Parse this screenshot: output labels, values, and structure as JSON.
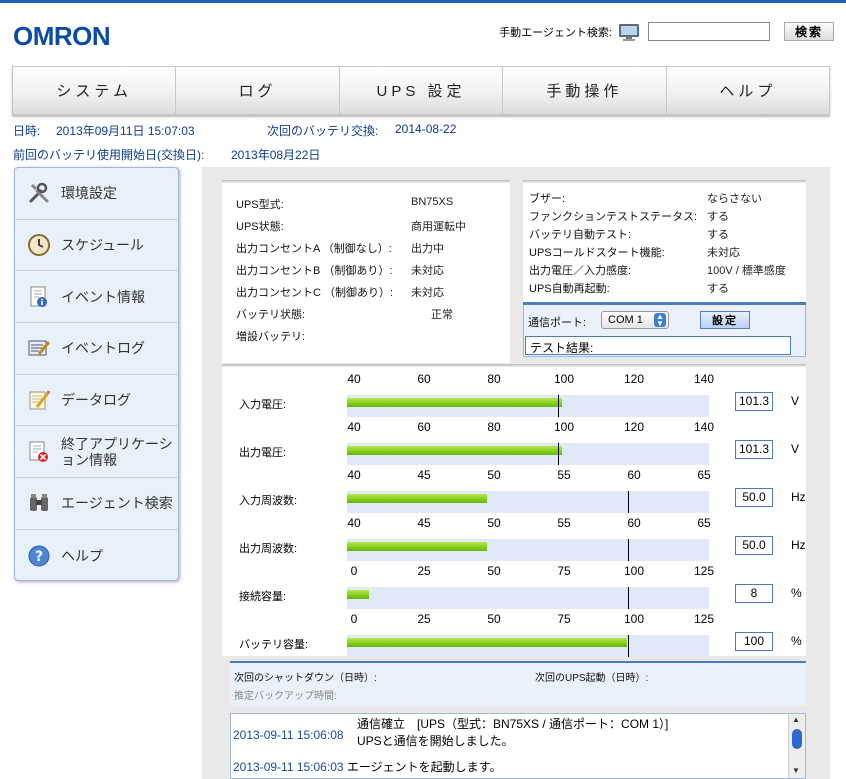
{
  "header": {
    "logo": "OMRON",
    "agent_search_label": "手動エージェント検索:",
    "search_input_value": "",
    "search_button": "検索"
  },
  "nav": {
    "tabs": [
      "システム",
      "ログ",
      "UPS 設定",
      "手動操作",
      "ヘルプ"
    ]
  },
  "info": {
    "datetime_label": "日時:",
    "datetime_value": "2013年09月11日 15:07:03",
    "next_battery_label": "次回のバッテリ交換:",
    "next_battery_value": "2014-08-22",
    "battery_start_label": "前回のバッテリ使用開始日(交換日):",
    "battery_start_value": "2013年08月22日"
  },
  "sidebar": {
    "items": [
      {
        "label": "環境設定",
        "icon": "tools-icon"
      },
      {
        "label": "スケジュール",
        "icon": "clock-icon"
      },
      {
        "label": "イベント情報",
        "icon": "info-document-icon"
      },
      {
        "label": "イベントログ",
        "icon": "log-edit-icon"
      },
      {
        "label": "データログ",
        "icon": "notepad-pencil-icon"
      },
      {
        "label": "終了アプリケーション情報",
        "icon": "app-close-icon"
      },
      {
        "label": "エージェント検索",
        "icon": "binoculars-icon"
      },
      {
        "label": "ヘルプ",
        "icon": "help-icon"
      }
    ]
  },
  "status": {
    "left": [
      {
        "label": "UPS型式:",
        "value": "BN75XS"
      },
      {
        "label": "UPS状態:",
        "value": "商用運転中"
      },
      {
        "label": "出力コンセントA （制御なし）:",
        "value": "出力中"
      },
      {
        "label": "出力コンセントB （制御あり）:",
        "value": "未対応"
      },
      {
        "label": "出力コンセントC （制御あり）:",
        "value": "未対応"
      },
      {
        "label": "バッテリ状態:",
        "value": "正常"
      },
      {
        "label": "増設バッテリ:",
        "value": ""
      }
    ],
    "right": [
      {
        "label": "ブザー:",
        "value": "ならさない"
      },
      {
        "label": "ファンクションテストステータス:",
        "value": "する"
      },
      {
        "label": "バッテリ自動テスト:",
        "value": "する"
      },
      {
        "label": "UPSコールドスタート機能:",
        "value": "未対応"
      },
      {
        "label": "出力電圧／入力感度:",
        "value": "100V / 標準感度"
      },
      {
        "label": "UPS自動再起動:",
        "value": "する"
      }
    ]
  },
  "comm": {
    "port_label": "通信ポート:",
    "port_value": "COM 1",
    "set_button": "設定",
    "test_result": "テスト結果:"
  },
  "gauges": [
    {
      "name": "入力電圧:",
      "ticks": [
        "40",
        "60",
        "80",
        "100",
        "120",
        "140"
      ],
      "min": 40,
      "max": 140,
      "value": 101.3,
      "display": "101.3",
      "unit": "V",
      "marker": 100
    },
    {
      "name": "出力電圧:",
      "ticks": [
        "40",
        "60",
        "80",
        "100",
        "120",
        "140"
      ],
      "min": 40,
      "max": 140,
      "value": 101.3,
      "display": "101.3",
      "unit": "V",
      "marker": 100
    },
    {
      "name": "入力周波数:",
      "ticks": [
        "40",
        "45",
        "50",
        "55",
        "60",
        "65"
      ],
      "min": 40,
      "max": 65,
      "value": 50.0,
      "display": "50.0",
      "unit": "Hz",
      "marker": 60
    },
    {
      "name": "出力周波数:",
      "ticks": [
        "40",
        "45",
        "50",
        "55",
        "60",
        "65"
      ],
      "min": 40,
      "max": 65,
      "value": 50.0,
      "display": "50.0",
      "unit": "Hz",
      "marker": 60
    },
    {
      "name": "接続容量:",
      "ticks": [
        "0",
        "25",
        "50",
        "75",
        "100",
        "125"
      ],
      "min": 0,
      "max": 125,
      "value": 8,
      "display": "8",
      "unit": "%",
      "marker": 100
    },
    {
      "name": "バッテリ容量:",
      "ticks": [
        "0",
        "25",
        "50",
        "75",
        "100",
        "125"
      ],
      "min": 0,
      "max": 125,
      "value": 100,
      "display": "100",
      "unit": "%",
      "marker": 100
    }
  ],
  "shutdown": {
    "next_shutdown_label": "次回のシャットダウン（日時）:",
    "next_startup_label": "次回のUPS起動（日時）:",
    "backup_time_label": "推定バックアップ時間:"
  },
  "log": [
    {
      "ts": "2013-09-11 15:06:08",
      "msg": "通信確立　[UPS（型式：BN75XS / 通信ポート：COM 1）] UPSと通信を開始しました。"
    },
    {
      "ts": "2013-09-11 15:06:03",
      "msg": "エージェントを起動します。"
    }
  ],
  "colors": {
    "brand": "#0b4aa6",
    "accent": "#4a7cc3",
    "gauge_fill": "#64b800"
  }
}
